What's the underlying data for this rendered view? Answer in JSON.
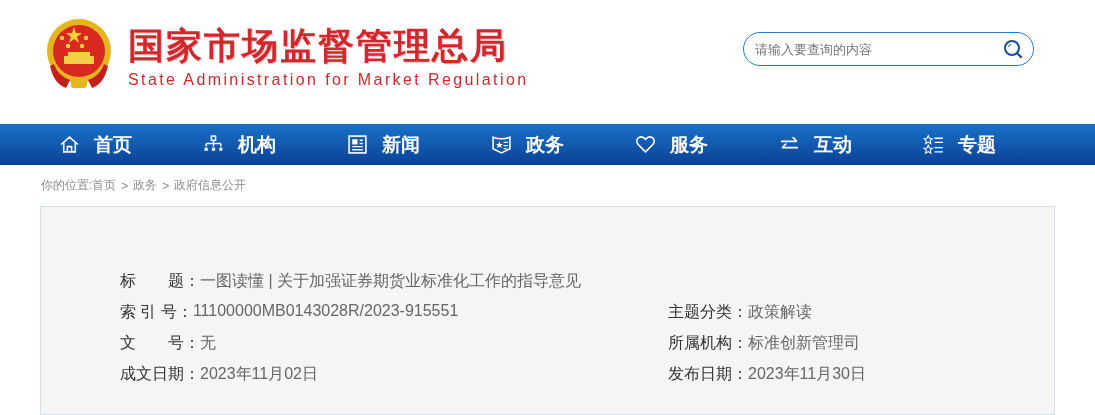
{
  "header": {
    "title": "国家市场监督管理总局",
    "subtitle": "State Administration for Market Regulation"
  },
  "search": {
    "placeholder": "请输入要查询的内容"
  },
  "nav": [
    {
      "label": "首页"
    },
    {
      "label": "机构"
    },
    {
      "label": "新闻"
    },
    {
      "label": "政务"
    },
    {
      "label": "服务"
    },
    {
      "label": "互动"
    },
    {
      "label": "专题"
    }
  ],
  "breadcrumb": {
    "prefix": "你的位置:",
    "items": [
      {
        "label": "首页"
      },
      {
        "label": "政务"
      },
      {
        "label": "政府信息公开"
      }
    ],
    "separator": ">"
  },
  "meta": [
    {
      "label": "标　　题：",
      "value": "一图读懂 | 关于加强证券期货业标准化工作的指导意见"
    },
    {
      "label": "索 引 号：",
      "value": "11100000MB0143028R/2023-915551",
      "label_2": "主题分类：",
      "value_2": "政策解读"
    },
    {
      "label": "文　　号：",
      "value": "无",
      "label_2": "所属机构：",
      "value_2": "标准创新管理司"
    },
    {
      "label": "成文日期：",
      "value": "2023年11月02日",
      "label_2": "发布日期：",
      "value_2": "2023年11月30日"
    }
  ]
}
